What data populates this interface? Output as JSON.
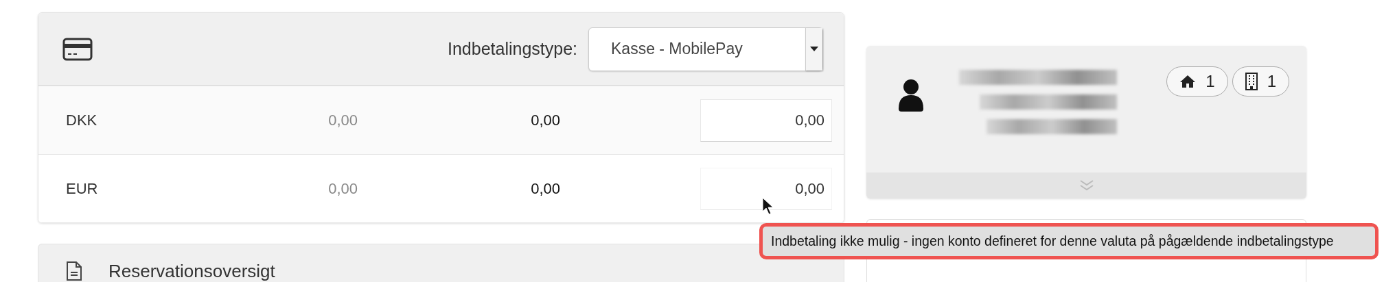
{
  "payment_panel": {
    "type_label": "Indbetalingstype:",
    "type_select": {
      "value": "Kasse - MobilePay"
    },
    "rows": [
      {
        "currency": "DKK",
        "column_2": "0,00",
        "column_3": "0,00",
        "amount": "0,00",
        "disabled": false
      },
      {
        "currency": "EUR",
        "column_2": "0,00",
        "column_3": "0,00",
        "amount": "0,00",
        "disabled": true
      }
    ]
  },
  "reservation_panel": {
    "title": "Reservationsoversigt"
  },
  "guest_card": {
    "badges": [
      {
        "kind": "home",
        "count": "1"
      },
      {
        "kind": "building",
        "count": "1"
      }
    ]
  },
  "tooltip": {
    "text": "Indbetaling ikke mulig - ingen konto defineret for denne valuta på pågældende indbetalingstype"
  }
}
